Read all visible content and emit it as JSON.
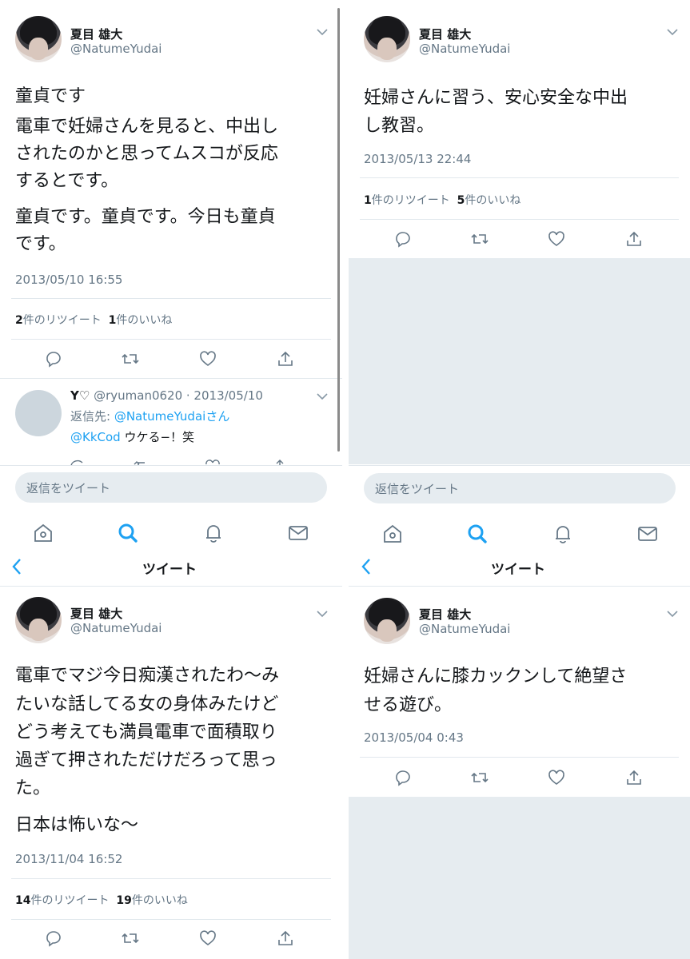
{
  "user": {
    "name": "夏目 雄大",
    "handle": "@NatumeYudai"
  },
  "actions": {
    "reply_icon": "reply-icon",
    "retweet_icon": "retweet-icon",
    "like_icon": "heart-icon",
    "share_icon": "share-icon"
  },
  "tabbar": {
    "home_icon": "home-icon",
    "search_icon": "search-icon",
    "notifications_icon": "bell-icon",
    "messages_icon": "mail-icon",
    "active_color": "#1da1f2"
  },
  "nav": {
    "title": "ツイート"
  },
  "reply_box": {
    "placeholder": "返信をツイート"
  },
  "tweets": [
    {
      "text": [
        "童貞です",
        "電車で妊婦さんを見ると、中出し",
        "されたのかと思ってムスコが反応",
        "するとです。"
      ],
      "text2": [
        "童貞です。童貞です。今日も童貞",
        "です。"
      ],
      "timestamp": "2013/05/10 16:55",
      "retweets": "2",
      "retweets_label": "件のリツイート",
      "likes": "1",
      "likes_label": "件のいいね"
    },
    {
      "text": [
        "妊婦さんに習う、安心安全な中出",
        "し教習。"
      ],
      "timestamp": "2013/05/13 22:44",
      "retweets": "1",
      "retweets_label": "件のリツイート",
      "likes": "5",
      "likes_label": "件のいいね"
    },
    {
      "text": [
        "電車でマジ今日痴漢されたわ〜み",
        "たいな話してる女の身体みたけど",
        "どう考えても満員電車で面積取り",
        "過ぎて押されただけだろって思っ",
        "た。"
      ],
      "text2": [
        "日本は怖いな〜"
      ],
      "timestamp": "2013/11/04 16:52",
      "retweets": "14",
      "retweets_label": "件のリツイート",
      "likes": "19",
      "likes_label": "件のいいね"
    },
    {
      "text": [
        "妊婦さんに膝カックンして絶望さ",
        "せる遊び。"
      ],
      "timestamp": "2013/05/04 0:43"
    }
  ],
  "reply": {
    "name": "Y♡",
    "meta": "@ryuman0620 · 2013/05/10",
    "reply_to_prefix": "返信先: ",
    "reply_to_handle": "@NatumeYudai",
    "reply_to_suffix": "さん",
    "mention": "@KkCod",
    "body": " ウケる−！笑"
  }
}
